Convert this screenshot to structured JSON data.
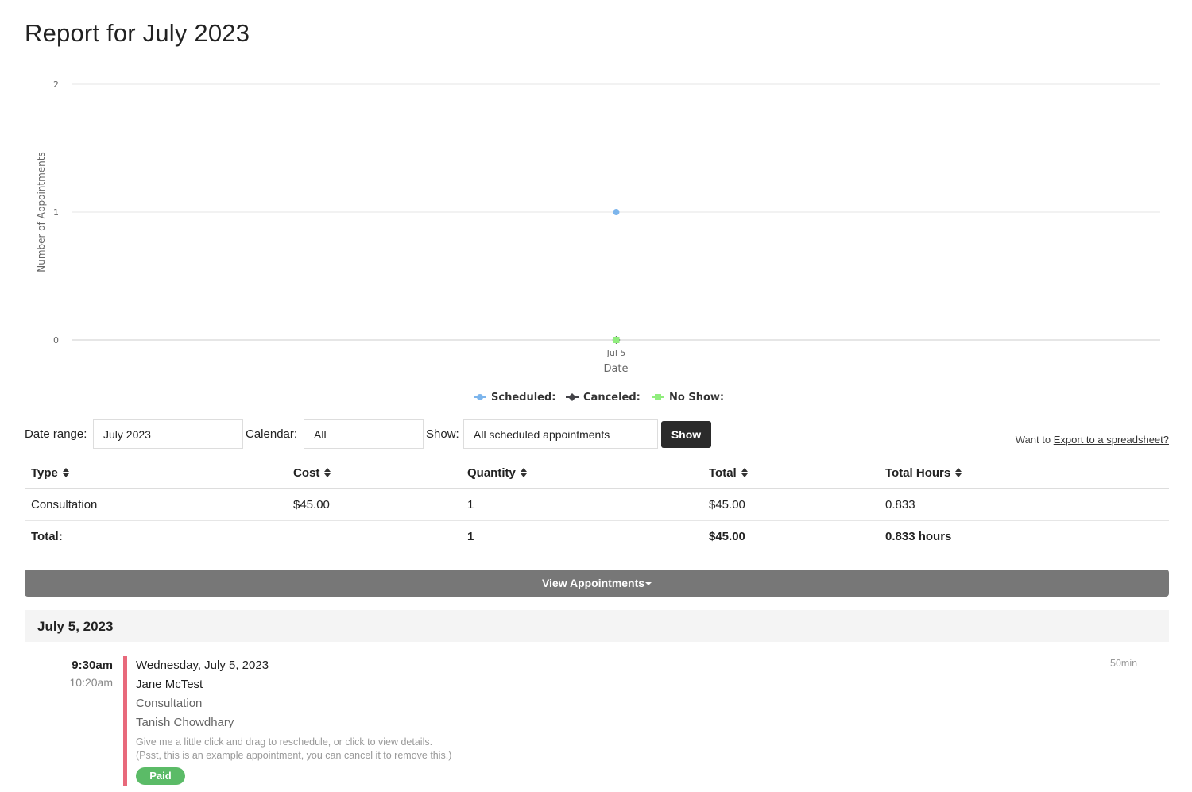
{
  "page": {
    "title": "Report for July 2023"
  },
  "chart_data": {
    "type": "line",
    "x": [
      "Jul 5"
    ],
    "series": [
      {
        "name": "Scheduled:",
        "values": [
          1
        ],
        "color": "#7cb5ec",
        "marker": "circle"
      },
      {
        "name": "Canceled:",
        "values": [
          0
        ],
        "color": "#434348",
        "marker": "diamond"
      },
      {
        "name": "No Show:",
        "values": [
          0
        ],
        "color": "#90ed7d",
        "marker": "square"
      }
    ],
    "xlabel": "Date",
    "ylabel": "Number of Appointments",
    "yticks": [
      0,
      1,
      2
    ],
    "ylim": [
      0,
      2
    ],
    "grid": true,
    "legend": "bottom-center"
  },
  "filters": {
    "date_range_label": "Date range:",
    "date_range_value": "July 2023",
    "calendar_label": "Calendar:",
    "calendar_value": "All",
    "show_label": "Show:",
    "show_value": "All scheduled appointments",
    "show_button": "Show",
    "export_prefix": "Want to",
    "export_link": "Export to a spreadsheet?"
  },
  "summary": {
    "headers": [
      "Type",
      "Cost",
      "Quantity",
      "Total",
      "Total Hours"
    ],
    "rows": [
      [
        "Consultation",
        "$45.00",
        "1",
        "$45.00",
        "0.833"
      ]
    ],
    "total": [
      "Total:",
      "",
      "1",
      "$45.00",
      "0.833 hours"
    ]
  },
  "appointments": {
    "toggle_label": "View Appointments",
    "day_heading": "July 5, 2023",
    "items": [
      {
        "start": "9:30am",
        "end": "10:20am",
        "date": "Wednesday, July 5, 2023",
        "client": "Jane McTest",
        "type": "Consultation",
        "staff": "Tanish Chowdhary",
        "note1": "Give me a little click and drag to reschedule, or click to view details.",
        "note2": "(Psst, this is an example appointment, you can cancel it to remove this.)",
        "status": "Paid",
        "duration": "50min"
      }
    ]
  }
}
